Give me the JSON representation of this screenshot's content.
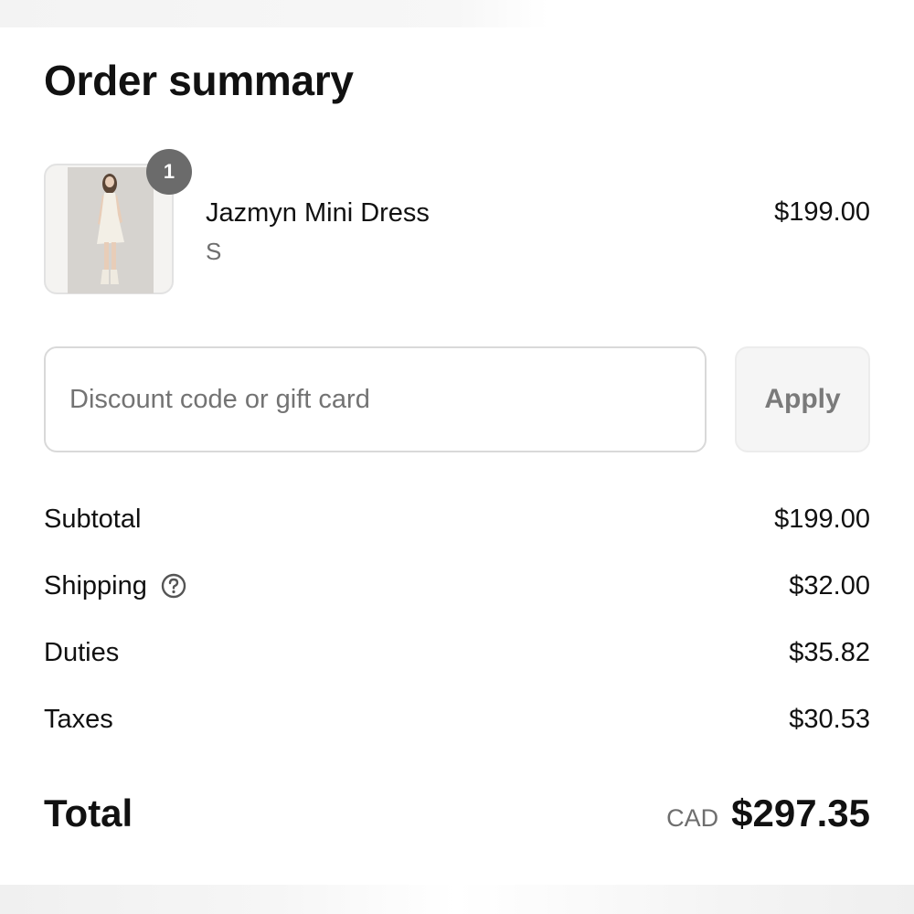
{
  "order_summary": {
    "title": "Order summary"
  },
  "line_item": {
    "quantity": "1",
    "name": "Jazmyn Mini Dress",
    "variant": "S",
    "price": "$199.00",
    "image_icon": "product-photo"
  },
  "discount": {
    "placeholder": "Discount code or gift card",
    "value": "",
    "apply_label": "Apply"
  },
  "costs": {
    "subtotal_label": "Subtotal",
    "subtotal_value": "$199.00",
    "shipping_label": "Shipping",
    "shipping_value": "$32.00",
    "shipping_help_icon": "question-circle-icon",
    "duties_label": "Duties",
    "duties_value": "$35.82",
    "taxes_label": "Taxes",
    "taxes_value": "$30.53"
  },
  "total": {
    "label": "Total",
    "currency": "CAD",
    "amount": "$297.35"
  }
}
